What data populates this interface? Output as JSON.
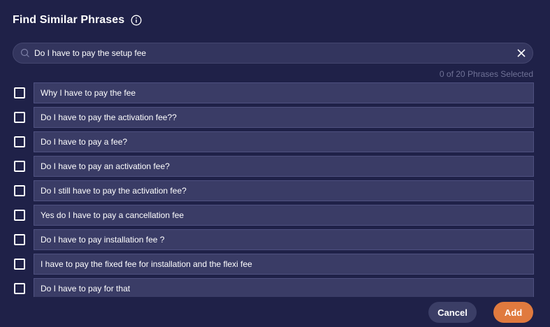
{
  "dialog": {
    "title": "Find Similar Phrases",
    "info_icon": "info-circle-icon"
  },
  "search": {
    "icon": "search-icon",
    "value": "Do I have to pay the setup fee",
    "clear_icon": "close-icon"
  },
  "counter": "0 of 20 Phrases Selected",
  "phrases": [
    {
      "text": "Why I have to pay the fee",
      "checked": false
    },
    {
      "text": "Do I have to pay the activation fee??",
      "checked": false
    },
    {
      "text": "Do I have to pay a fee?",
      "checked": false
    },
    {
      "text": "Do I have to pay an activation fee?",
      "checked": false
    },
    {
      "text": "Do I still have to pay the activation fee?",
      "checked": false
    },
    {
      "text": "Yes do I have to pay a cancellation fee",
      "checked": false
    },
    {
      "text": "Do I have to pay installation fee ?",
      "checked": false
    },
    {
      "text": "I have to pay the fixed fee for installation and the flexi fee",
      "checked": false
    },
    {
      "text": "Do I have to pay for that",
      "checked": false
    }
  ],
  "buttons": {
    "cancel": "Cancel",
    "add": "Add"
  },
  "colors": {
    "background": "#1f2148",
    "row_background": "#3a3c66",
    "accent": "#e07a3e",
    "muted_text": "#6f7296"
  }
}
